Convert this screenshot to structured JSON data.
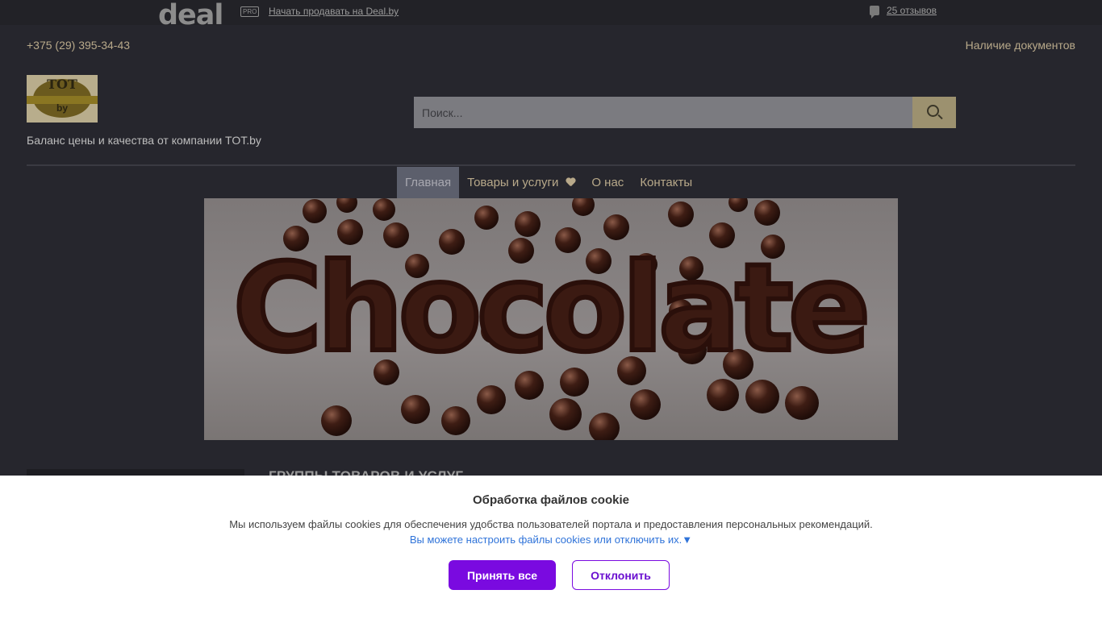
{
  "topbar": {
    "logo_text": "deal",
    "pro_label": "PRO",
    "sell_link": "Начать продавать на Deal.by",
    "reviews_link": "25 отзывов"
  },
  "header": {
    "phone": "+375 (29) 395-34-43",
    "docs_link": "Наличие документов",
    "logo_text_top": "ТОТ",
    "logo_text_bottom": "by",
    "slogan": "Баланс цены и качества от компании TOT.by"
  },
  "search": {
    "placeholder": "Поиск..."
  },
  "nav": {
    "items": [
      {
        "label": "Главная"
      },
      {
        "label": "Товары и услуги"
      },
      {
        "label": "О нас"
      },
      {
        "label": "Контакты"
      }
    ]
  },
  "banner": {
    "text": "Chocolate"
  },
  "main": {
    "groups_title": "ГРУППЫ ТОВАРОВ И УСЛУГ"
  },
  "cookie": {
    "title": "Обработка файлов cookie",
    "text": "Мы используем файлы cookies для обеспечения удобства пользователей портала и предоставления персональных рекомендаций.",
    "link": "Вы можете настроить файлы cookies или отключить их.▼",
    "accept_label": "Принять все",
    "decline_label": "Отклонить"
  },
  "colors": {
    "page_bg": "#26262d",
    "accent_gold": "#b8a98a",
    "cookie_button": "#7a0ae0",
    "cookie_link": "#2f73d9"
  }
}
